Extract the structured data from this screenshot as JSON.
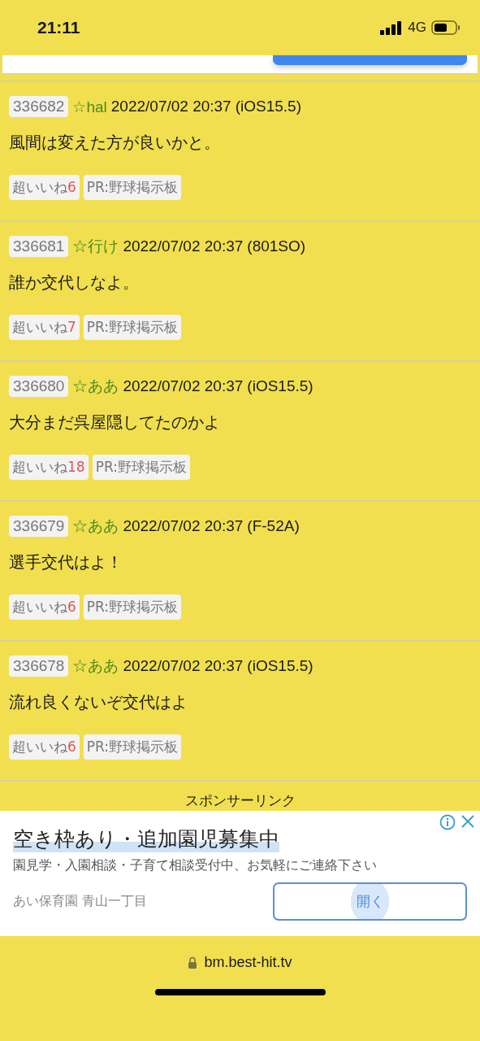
{
  "status_bar": {
    "time": "21:11",
    "network": "4G"
  },
  "posts": [
    {
      "number": "336682",
      "name": "☆hal",
      "date": "2022/07/02 20:37",
      "device": "(iOS15.5)",
      "body": "風間は変えた方が良いかと。",
      "like_label": "超いいね",
      "likes": "6",
      "pr": "PR:野球掲示板"
    },
    {
      "number": "336681",
      "name": "☆行け",
      "date": "2022/07/02 20:37",
      "device": "(801SO)",
      "body": "誰か交代しなよ。",
      "like_label": "超いいね",
      "likes": "7",
      "pr": "PR:野球掲示板"
    },
    {
      "number": "336680",
      "name": "☆ああ",
      "date": "2022/07/02 20:37",
      "device": "(iOS15.5)",
      "body": "大分まだ呉屋隠してたのかよ",
      "like_label": "超いいね",
      "likes": "18",
      "pr": "PR:野球掲示板"
    },
    {
      "number": "336679",
      "name": "☆ああ",
      "date": "2022/07/02 20:37",
      "device": "(F-52A)",
      "body": "選手交代はよ！",
      "like_label": "超いいね",
      "likes": "6",
      "pr": "PR:野球掲示板"
    },
    {
      "number": "336678",
      "name": "☆ああ",
      "date": "2022/07/02 20:37",
      "device": "(iOS15.5)",
      "body": "流れ良くないぞ交代はよ",
      "like_label": "超いいね",
      "likes": "6",
      "pr": "PR:野球掲示板"
    }
  ],
  "sponsor_label": "スポンサーリンク",
  "ad": {
    "title": "空き枠あり・追加園児募集中",
    "description": "園見学・入園相談・子育て相談受付中、お気軽にご連絡下さい",
    "advertiser": "あい保育園 青山一丁目",
    "button": "開く"
  },
  "address_bar": {
    "url": "bm.best-hit.tv"
  }
}
